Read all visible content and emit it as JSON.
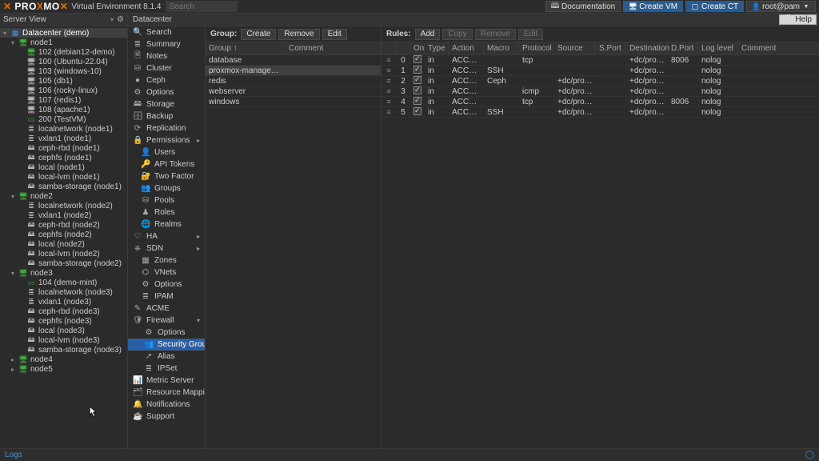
{
  "header": {
    "product": "PROXMOX",
    "ve": "Virtual Environment 8.1.4",
    "search_placeholder": "Search",
    "doc": "Documentation",
    "create_vm": "Create VM",
    "create_ct": "Create CT",
    "user": "root@pam"
  },
  "viewbar": {
    "mode": "Server View",
    "crumb": "Datacenter",
    "help": "Help"
  },
  "tree": [
    {
      "l": 0,
      "t": "dc",
      "exp": "▾",
      "icon": "▦",
      "cls": "blue",
      "label": "Datacenter (demo)"
    },
    {
      "l": 1,
      "t": "node",
      "exp": "▾",
      "icon": "🖥",
      "cls": "green",
      "label": "node1"
    },
    {
      "l": 2,
      "t": "vm",
      "icon": "🖥",
      "cls": "green",
      "label": "102 (debian12-demo)"
    },
    {
      "l": 2,
      "t": "vm",
      "icon": "🖥",
      "cls": "white",
      "label": "100 (Ubuntu-22.04)"
    },
    {
      "l": 2,
      "t": "vm",
      "icon": "🖥",
      "cls": "white",
      "label": "103 (windows-10)"
    },
    {
      "l": 2,
      "t": "vm",
      "icon": "🖥",
      "cls": "white",
      "label": "105 (db1)"
    },
    {
      "l": 2,
      "t": "vm",
      "icon": "🖥",
      "cls": "white",
      "label": "106 (rocky-linux)"
    },
    {
      "l": 2,
      "t": "vm",
      "icon": "🖥",
      "cls": "white",
      "label": "107 (redis1)"
    },
    {
      "l": 2,
      "t": "vm",
      "icon": "🖥",
      "cls": "white",
      "label": "108 (apache1)"
    },
    {
      "l": 2,
      "t": "ct",
      "icon": "▭",
      "cls": "green",
      "label": "200 (TestVM)"
    },
    {
      "l": 2,
      "t": "st",
      "icon": "≣",
      "cls": "store",
      "label": "localnetwork (node1)"
    },
    {
      "l": 2,
      "t": "st",
      "icon": "≣",
      "cls": "store",
      "label": "vxlan1 (node1)"
    },
    {
      "l": 2,
      "t": "st",
      "icon": "🖴",
      "cls": "store",
      "label": "ceph-rbd (node1)"
    },
    {
      "l": 2,
      "t": "st",
      "icon": "🖴",
      "cls": "store",
      "label": "cephfs (node1)"
    },
    {
      "l": 2,
      "t": "st",
      "icon": "🖴",
      "cls": "store",
      "label": "local (node1)"
    },
    {
      "l": 2,
      "t": "st",
      "icon": "🖴",
      "cls": "store",
      "label": "local-lvm (node1)"
    },
    {
      "l": 2,
      "t": "st",
      "icon": "🖴",
      "cls": "store",
      "label": "samba-storage (node1)"
    },
    {
      "l": 1,
      "t": "node",
      "exp": "▾",
      "icon": "🖥",
      "cls": "green",
      "label": "node2"
    },
    {
      "l": 2,
      "t": "st",
      "icon": "≣",
      "cls": "store",
      "label": "localnetwork (node2)"
    },
    {
      "l": 2,
      "t": "st",
      "icon": "≣",
      "cls": "store",
      "label": "vxlan1 (node2)"
    },
    {
      "l": 2,
      "t": "st",
      "icon": "🖴",
      "cls": "store",
      "label": "ceph-rbd (node2)"
    },
    {
      "l": 2,
      "t": "st",
      "icon": "🖴",
      "cls": "store",
      "label": "cephfs (node2)"
    },
    {
      "l": 2,
      "t": "st",
      "icon": "🖴",
      "cls": "store",
      "label": "local (node2)"
    },
    {
      "l": 2,
      "t": "st",
      "icon": "🖴",
      "cls": "store",
      "label": "local-lvm (node2)"
    },
    {
      "l": 2,
      "t": "st",
      "icon": "🖴",
      "cls": "store",
      "label": "samba-storage (node2)"
    },
    {
      "l": 1,
      "t": "node",
      "exp": "▾",
      "icon": "🖥",
      "cls": "green",
      "label": "node3"
    },
    {
      "l": 2,
      "t": "ct",
      "icon": "▭",
      "cls": "green",
      "label": "104 (demo-mint)"
    },
    {
      "l": 2,
      "t": "st",
      "icon": "≣",
      "cls": "store",
      "label": "localnetwork (node3)"
    },
    {
      "l": 2,
      "t": "st",
      "icon": "≣",
      "cls": "store",
      "label": "vxlan1 (node3)"
    },
    {
      "l": 2,
      "t": "st",
      "icon": "🖴",
      "cls": "store",
      "label": "ceph-rbd (node3)"
    },
    {
      "l": 2,
      "t": "st",
      "icon": "🖴",
      "cls": "store",
      "label": "cephfs (node3)"
    },
    {
      "l": 2,
      "t": "st",
      "icon": "🖴",
      "cls": "store",
      "label": "local (node3)"
    },
    {
      "l": 2,
      "t": "st",
      "icon": "🖴",
      "cls": "store",
      "label": "local-lvm (node3)"
    },
    {
      "l": 2,
      "t": "st",
      "icon": "🖴",
      "cls": "store",
      "label": "samba-storage (node3)"
    },
    {
      "l": 1,
      "t": "node",
      "exp": "▸",
      "icon": "🖥",
      "cls": "green",
      "label": "node4"
    },
    {
      "l": 1,
      "t": "node",
      "exp": "▸",
      "icon": "🖥",
      "cls": "green",
      "label": "node5"
    }
  ],
  "menu": [
    {
      "icon": "🔍",
      "label": "Search"
    },
    {
      "icon": "≣",
      "label": "Summary"
    },
    {
      "icon": "🗎",
      "label": "Notes"
    },
    {
      "icon": "⛁",
      "label": "Cluster"
    },
    {
      "icon": "●",
      "label": "Ceph"
    },
    {
      "icon": "⚙",
      "label": "Options"
    },
    {
      "icon": "🖴",
      "label": "Storage"
    },
    {
      "icon": "🗄",
      "label": "Backup"
    },
    {
      "icon": "⟳",
      "label": "Replication"
    },
    {
      "icon": "🔒",
      "label": "Permissions",
      "chev": "▸",
      "sub": false
    },
    {
      "icon": "👤",
      "label": "Users",
      "sub": true
    },
    {
      "icon": "🔑",
      "label": "API Tokens",
      "sub": true
    },
    {
      "icon": "🔐",
      "label": "Two Factor",
      "sub": true
    },
    {
      "icon": "👥",
      "label": "Groups",
      "sub": true
    },
    {
      "icon": "⛁",
      "label": "Pools",
      "sub": true
    },
    {
      "icon": "♟",
      "label": "Roles",
      "sub": true
    },
    {
      "icon": "🌐",
      "label": "Realms",
      "sub": true
    },
    {
      "icon": "♡",
      "label": "HA",
      "chev": "▸"
    },
    {
      "icon": "⎈",
      "label": "SDN",
      "chev": "▸"
    },
    {
      "icon": "▦",
      "label": "Zones",
      "sub": true
    },
    {
      "icon": "⌬",
      "label": "VNets",
      "sub": true
    },
    {
      "icon": "⚙",
      "label": "Options",
      "sub": true
    },
    {
      "icon": "≣",
      "label": "IPAM",
      "sub": true
    },
    {
      "icon": "✎",
      "label": "ACME"
    },
    {
      "icon": "🛡",
      "label": "Firewall",
      "chev": "▾"
    },
    {
      "icon": "⚙",
      "label": "Options",
      "sub2": true
    },
    {
      "icon": "👥",
      "label": "Security Group",
      "sub2": true,
      "active": true
    },
    {
      "icon": "↗",
      "label": "Alias",
      "sub2": true
    },
    {
      "icon": "≣",
      "label": "IPSet",
      "sub2": true
    },
    {
      "icon": "📊",
      "label": "Metric Server"
    },
    {
      "icon": "🗂",
      "label": "Resource Mappings"
    },
    {
      "icon": "🔔",
      "label": "Notifications"
    },
    {
      "icon": "☕",
      "label": "Support"
    }
  ],
  "groups": {
    "label": "Group:",
    "create": "Create",
    "remove": "Remove",
    "edit": "Edit",
    "head": {
      "group": "Group ↑",
      "comment": "Comment"
    },
    "rows": [
      {
        "g": "database",
        "c": ""
      },
      {
        "g": "proxmox-management",
        "c": "",
        "sel": true
      },
      {
        "g": "redis",
        "c": ""
      },
      {
        "g": "webserver",
        "c": ""
      },
      {
        "g": "windows",
        "c": ""
      }
    ]
  },
  "rules": {
    "label": "Rules:",
    "add": "Add",
    "copy": "Copy",
    "remove": "Remove",
    "edit": "Edit",
    "head": {
      "on": "On",
      "type": "Type",
      "action": "Action",
      "macro": "Macro",
      "proto": "Protocol",
      "source": "Source",
      "sport": "S.Port",
      "dest": "Destination",
      "dport": "D.Port",
      "log": "Log level",
      "comment": "Comment"
    },
    "rows": [
      {
        "n": "0",
        "on": true,
        "type": "in",
        "action": "ACCEPT",
        "macro": "",
        "proto": "tcp",
        "source": "",
        "sport": "",
        "dest": "+dc/proxm...",
        "dport": "8006",
        "log": "nolog"
      },
      {
        "n": "1",
        "on": true,
        "type": "in",
        "action": "ACCEPT",
        "macro": "SSH",
        "proto": "",
        "source": "",
        "sport": "",
        "dest": "+dc/proxm...",
        "dport": "",
        "log": "nolog"
      },
      {
        "n": "2",
        "on": true,
        "type": "in",
        "action": "ACCEPT",
        "macro": "Ceph",
        "proto": "",
        "source": "+dc/proxm...",
        "sport": "",
        "dest": "+dc/proxm...",
        "dport": "",
        "log": "nolog"
      },
      {
        "n": "3",
        "on": true,
        "type": "in",
        "action": "ACCEPT",
        "macro": "",
        "proto": "icmp",
        "source": "+dc/proxm...",
        "sport": "",
        "dest": "+dc/proxm...",
        "dport": "",
        "log": "nolog"
      },
      {
        "n": "4",
        "on": true,
        "type": "in",
        "action": "ACCEPT",
        "macro": "",
        "proto": "tcp",
        "source": "+dc/proxm...",
        "sport": "",
        "dest": "+dc/proxm...",
        "dport": "8006",
        "log": "nolog"
      },
      {
        "n": "5",
        "on": true,
        "type": "in",
        "action": "ACCEPT",
        "macro": "SSH",
        "proto": "",
        "source": "+dc/proxm...",
        "sport": "",
        "dest": "+dc/proxm...",
        "dport": "",
        "log": "nolog"
      }
    ]
  },
  "footer": {
    "logs": "Logs"
  }
}
